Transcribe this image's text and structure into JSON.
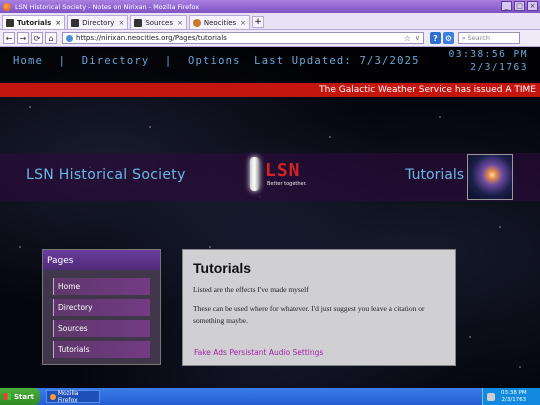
{
  "window": {
    "title": "LSN Historical Society - Notes on Nirixan - Mozilla Firefox",
    "controls": [
      "_",
      "□",
      "×"
    ]
  },
  "tabs": [
    {
      "label": "Tutorials",
      "active": true
    },
    {
      "label": "Directory",
      "active": false
    },
    {
      "label": "Sources",
      "active": false
    },
    {
      "label": "Neocities",
      "active": false
    }
  ],
  "newtab_label": "+",
  "toolbar": {
    "back": "←",
    "forward": "→",
    "reload": "⟳",
    "home": "⌂",
    "url": "https://nirixan.neocities.org/Pages/tutorials",
    "bookmark_star": "☆",
    "url_dropdown": "∨",
    "help": "?",
    "settings": "⚙",
    "search_placeholder": "Search"
  },
  "site": {
    "nav": {
      "home": "Home",
      "directory": "Directory",
      "options": "Options",
      "sep": "|"
    },
    "last_updated": "Last Updated: 7/3/2025",
    "clock_time": "03:38:56 PM",
    "clock_date": "2/3/1763",
    "alert": "The Galactic Weather Service has issued A TIME",
    "banner_left": "LSN Historical Society",
    "banner_right": "Tutorials",
    "logo_text": "LSN",
    "logo_tagline": "Better together."
  },
  "sidebar": {
    "title": "Pages",
    "items": [
      "Home",
      "Directory",
      "Sources",
      "Tutorials"
    ]
  },
  "main": {
    "heading": "Tutorials",
    "p1": "Listed are the effects I've made myself",
    "p2": "These can be used where for whatever. I'd just suggest you leave a citation or something maybe.",
    "link": "Fake Ads Persistant Audio Settings"
  },
  "taskbar": {
    "start": "Start",
    "item": "Mozilla Firefox",
    "time": "03:38 PM",
    "date": "2/3/1763"
  },
  "colors": {
    "accent": "#6ab8e6",
    "alert": "#c4150f",
    "link": "#a021a8",
    "panel_header": "#6b3d9e"
  }
}
